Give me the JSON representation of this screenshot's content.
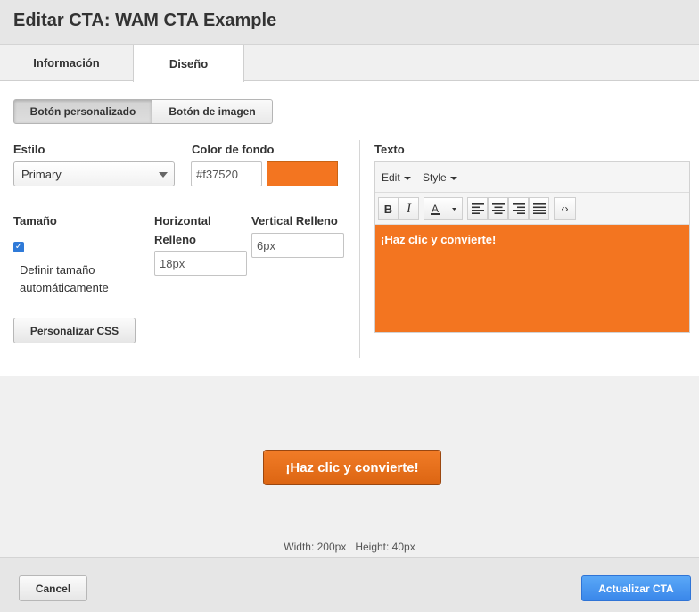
{
  "header": {
    "title": "Editar CTA: WAM CTA Example"
  },
  "tabs": [
    {
      "label": "Información"
    },
    {
      "label": "Diseño"
    }
  ],
  "button_type": {
    "custom_label": "Botón personalizado",
    "image_label": "Botón de imagen",
    "selected": "Botón personalizado"
  },
  "style": {
    "label": "Estilo",
    "value": "Primary"
  },
  "background": {
    "label": "Color de fondo",
    "value": "#f37520",
    "swatch_color": "#f37520"
  },
  "size": {
    "label": "Tamaño",
    "auto_label_line1": "Definir tamaño",
    "auto_label_line2": "automáticamente",
    "auto_checked": true
  },
  "padding": {
    "horizontal_label_line1": "Horizontal",
    "horizontal_label_line2": "Relleno",
    "horizontal_value": "18px",
    "vertical_label": "Vertical Relleno",
    "vertical_value": "6px"
  },
  "custom_css_label": "Personalizar CSS",
  "text_editor": {
    "label": "Texto",
    "menu_edit": "Edit",
    "menu_style": "Style",
    "content": "¡Haz clic y convierte!",
    "toolbar_icons": [
      "bold-icon",
      "italic-icon",
      "font-color-icon",
      "align-left-icon",
      "align-center-icon",
      "align-right-icon",
      "align-justify-icon",
      "source-code-icon"
    ]
  },
  "preview": {
    "button_label": "¡Haz clic y convierte!",
    "dimensions": "Width: 200px   Height: 40px"
  },
  "footer": {
    "cancel_label": "Cancel",
    "update_label": "Actualizar CTA"
  },
  "colors": {
    "accent": "#f37520",
    "primary_button": "#3a87ea"
  }
}
